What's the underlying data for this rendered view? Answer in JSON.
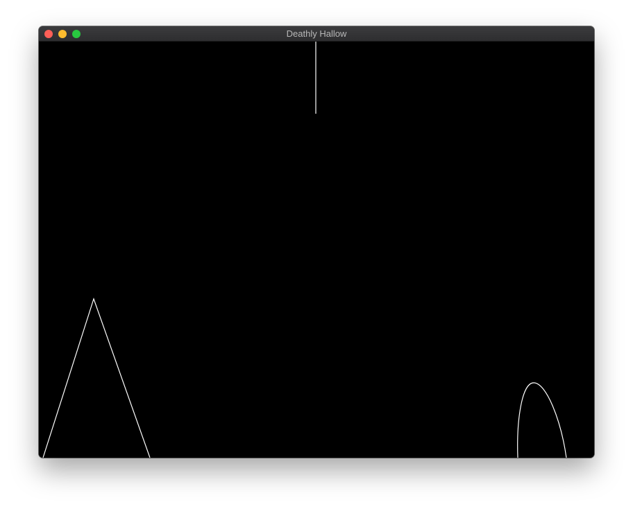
{
  "window": {
    "title": "Deathly Hallow",
    "buttons": {
      "close_color": "#ff5f57",
      "minimize_color": "#febc2e",
      "zoom_color": "#28c840"
    }
  },
  "canvas": {
    "background_color": "#000000",
    "stroke_color": "#ffffff"
  }
}
